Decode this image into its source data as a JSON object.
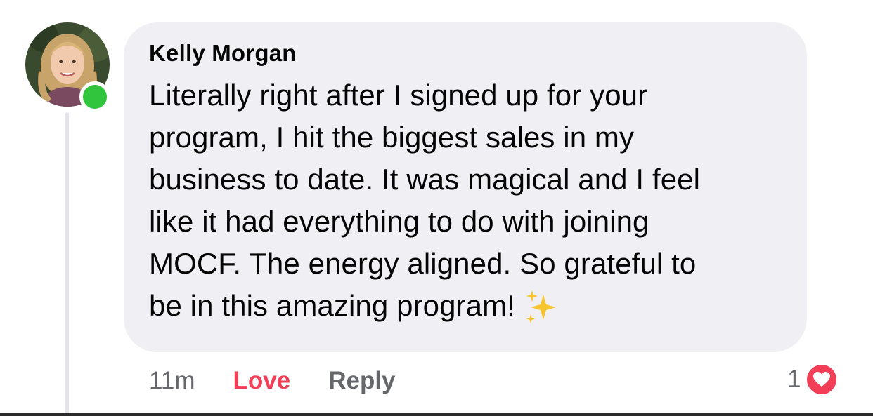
{
  "comment": {
    "author": "Kelly Morgan",
    "lines": [
      "Literally right after I signed up for your",
      "program, I hit the biggest sales in my",
      "business to date. It was magical and I feel",
      "like it had everything to do with joining",
      "MOCF. The energy aligned. So grateful to",
      "be in this amazing program!"
    ],
    "emoji_icon": "sparkles-icon",
    "online_status_color": "#31c53d"
  },
  "actions": {
    "time": "11m",
    "love_label": "Love",
    "reply_label": "Reply"
  },
  "reaction": {
    "count": "1",
    "icon": "heart-icon",
    "color": "#f33e58"
  }
}
